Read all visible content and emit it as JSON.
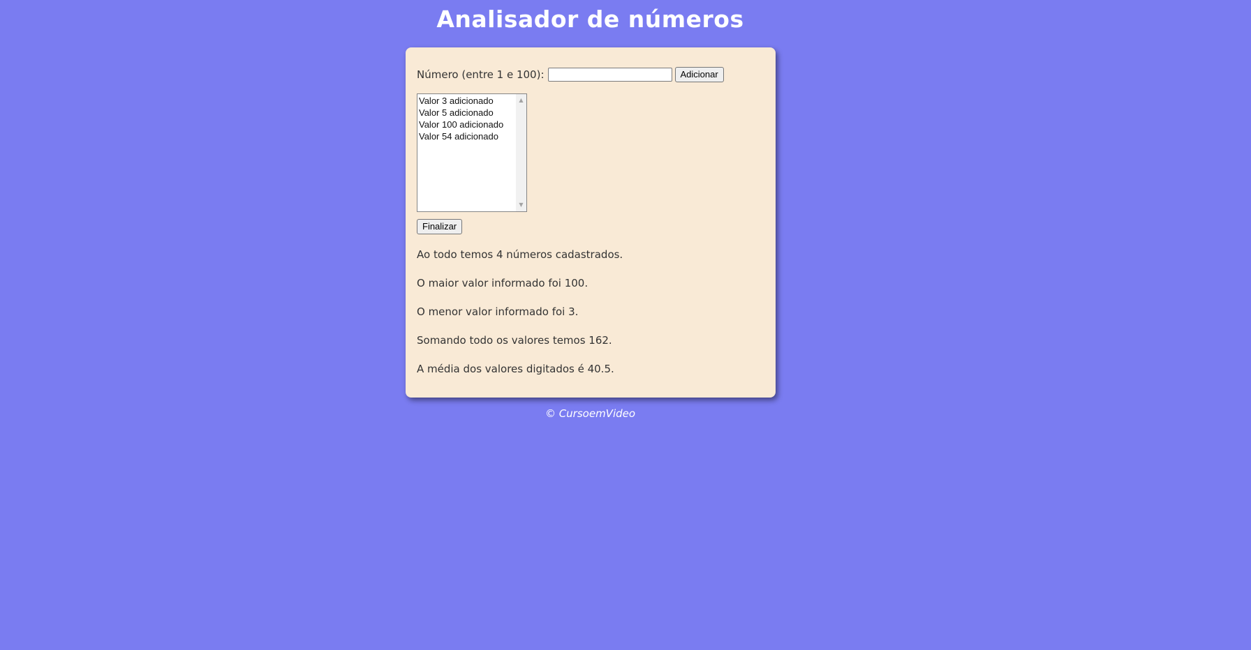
{
  "header": {
    "title": "Analisador de números"
  },
  "form": {
    "label": "Número (entre 1 e 100):",
    "input_value": "",
    "add_button": "Adicionar"
  },
  "list": {
    "items": [
      "Valor 3 adicionado",
      "Valor 5 adicionado",
      "Valor 100 adicionado",
      "Valor 54 adicionado"
    ]
  },
  "finalize_button": "Finalizar",
  "results": {
    "total": "Ao todo temos 4 números cadastrados.",
    "max": "O maior valor informado foi 100.",
    "min": "O menor valor informado foi 3.",
    "sum": "Somando todo os valores temos 162.",
    "avg": "A média dos valores digitados é 40.5."
  },
  "footer": {
    "text": "© CursoemVideo"
  },
  "colors": {
    "background": "#7a7cf1",
    "card": "#f9ead6"
  }
}
